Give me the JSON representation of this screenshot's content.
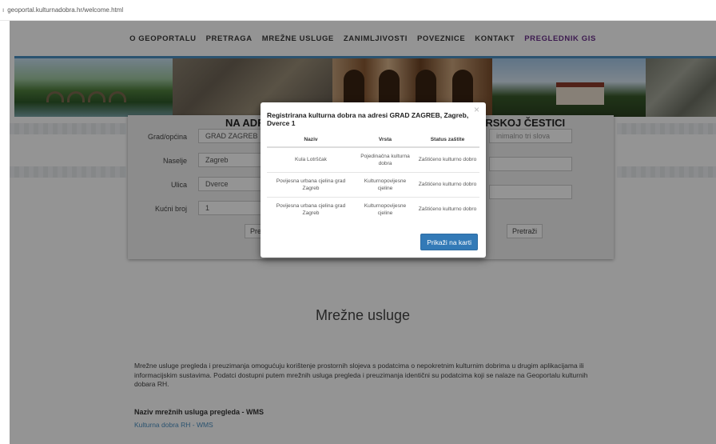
{
  "browser": {
    "url": "geoportal.kulturnadobra.hr/welcome.html"
  },
  "nav": {
    "items": [
      "O GEOPORTALU",
      "PRETRAGA",
      "MREŽNE USLUGE",
      "ZANIMLJIVOSTI",
      "POVEZNICE",
      "KONTAKT",
      "PREGLEDNIK GIS"
    ],
    "gis_color": "#6a2f8a"
  },
  "panel": {
    "title_left": "NA ADR",
    "title_right": "ARSKOJ ČESTICI",
    "fields": [
      {
        "label": "Grad/općina",
        "value": "GRAD ZAGREB"
      },
      {
        "label": "Naselje",
        "value": "Zagreb"
      },
      {
        "label": "Ulica",
        "value": "Dverce"
      },
      {
        "label": "Kućni broj",
        "value": "1"
      }
    ],
    "right_placeholder": "inimalno tri slova",
    "search_left": "Pre",
    "search_right": "Pretraži"
  },
  "modal": {
    "title": "Registrirana kulturna dobra na adresi GRAD ZAGREB, Zagreb, Dverce 1",
    "close": "×",
    "columns": [
      "Naziv",
      "Vrsta",
      "Status zaštite"
    ],
    "rows": [
      [
        "Kula Lotrščak",
        "Pojedinačna kulturna dobra",
        "Zaštićeno kulturno dobro"
      ],
      [
        "Povijesna urbana cjelina grad Zagreb",
        "Kulturnopovijesne cjeline",
        "Zaštićeno kulturno dobro"
      ],
      [
        "Povijesna urbana cjelina grad Zagreb",
        "Kulturnopovijesne cjeline",
        "Zaštićeno kulturno dobro"
      ]
    ],
    "button": "Prikaži na karti",
    "button_color": "#337ab7"
  },
  "content": {
    "section_title": "Mrežne usluge",
    "description": "Mrežne usluge pregleda i preuzimanja omogućuju korištenje prostornih slojeva s podatcima o nepokretnim kulturnim dobrima u drugim aplikacijama ili informacijskim sustavima. Podatci dostupni putem mrežnih usluga pregleda i preuzimanja identični su podatcima koji se nalaze na Geoportalu kulturnih dobara RH.",
    "subheading": "Naziv mrežnih usluga pregleda - WMS",
    "link": "Kulturna dobra RH - WMS"
  }
}
